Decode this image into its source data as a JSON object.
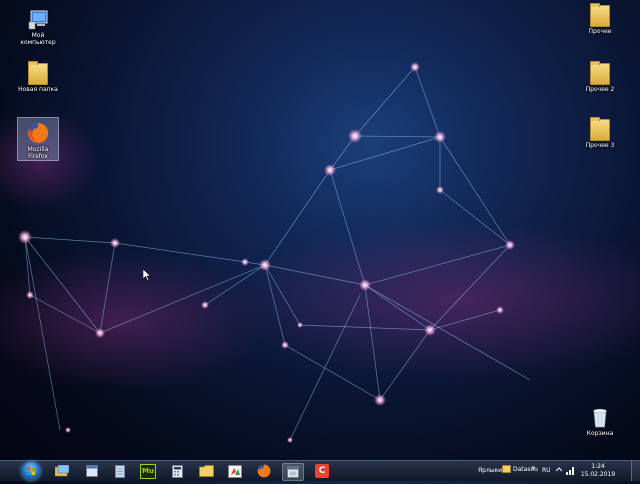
{
  "desktop": {
    "left_icons": [
      {
        "label": "Мой компьютер",
        "icon": "computer-icon"
      },
      {
        "label": "Новая папка",
        "icon": "folder-icon"
      },
      {
        "label": "Mozilla Firefox",
        "icon": "firefox-icon"
      }
    ],
    "right_icons": [
      {
        "label": "Прочее",
        "icon": "folder-icon"
      },
      {
        "label": "Прочее 2",
        "icon": "folder-icon"
      },
      {
        "label": "Прочее 3",
        "icon": "folder-icon"
      }
    ],
    "recycle_bin": {
      "label": "Корзина",
      "icon": "recycle-bin-icon"
    }
  },
  "taskbar": {
    "pinned": [
      {
        "name": "windows-explorer-icon"
      },
      {
        "name": "window-icon"
      },
      {
        "name": "document-icon"
      },
      {
        "name": "muse-icon",
        "text": "Mu"
      },
      {
        "name": "calculator-icon"
      },
      {
        "name": "folder-icon"
      },
      {
        "name": "paint-icon"
      },
      {
        "name": "firefox-icon"
      },
      {
        "name": "window-icon"
      },
      {
        "name": "app-c-icon",
        "text": "C"
      }
    ],
    "toolbar_label": "Ярлыки",
    "folder_label": "Datasou",
    "more_glyph": "»",
    "language": "RU",
    "time": "1:24",
    "date": "15.02.2019"
  },
  "colors": {
    "accent_pink": "#e35fb0",
    "line_blue": "#7fb8ff",
    "muse_green": "#9ad020",
    "app_c_red": "#e8432e"
  }
}
